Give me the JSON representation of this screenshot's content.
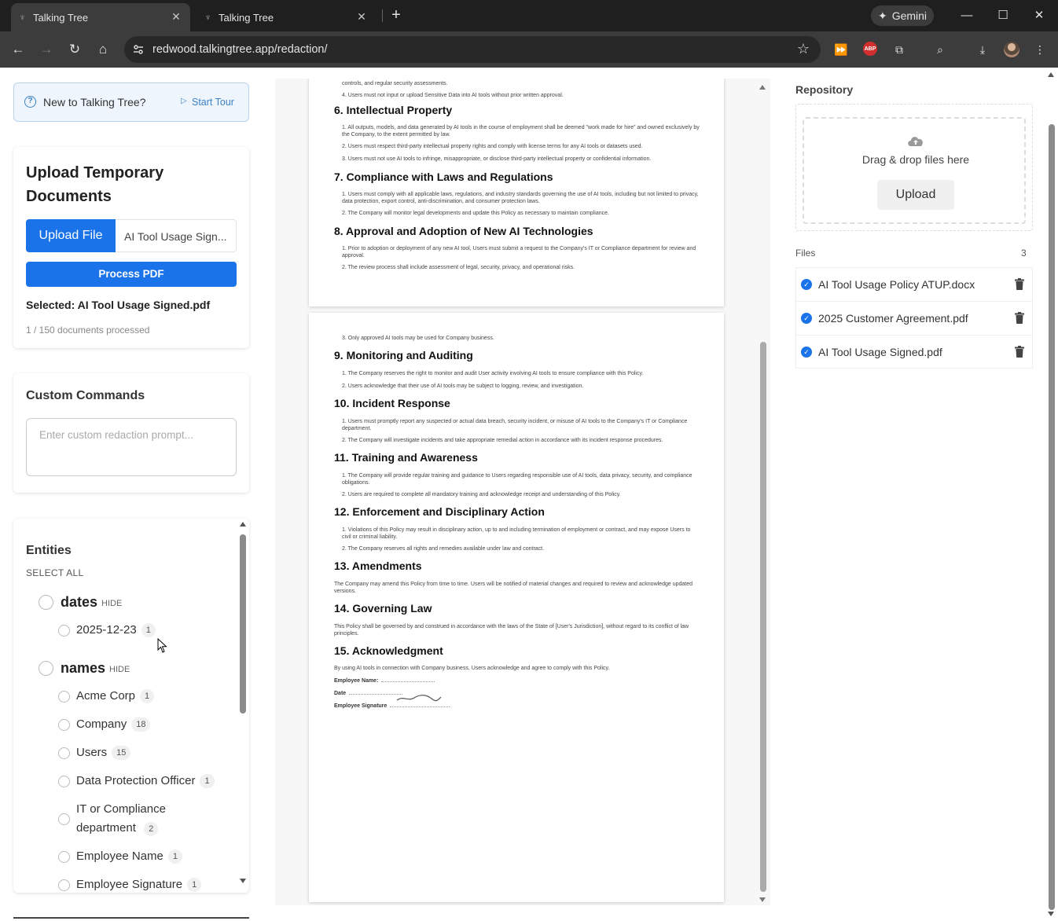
{
  "browser": {
    "tabs": [
      {
        "title": "Talking Tree",
        "active": true
      },
      {
        "title": "Talking Tree",
        "active": false
      }
    ],
    "gemini_label": "Gemini",
    "url": "redwood.talkingtree.app/redaction/",
    "abp_label": "ABP"
  },
  "tour": {
    "title": "New to Talking Tree?",
    "start_label": "Start Tour"
  },
  "upload": {
    "heading": "Upload Temporary Documents",
    "upload_file_label": "Upload File",
    "chosen_file": "AI Tool Usage Sign...",
    "process_label": "Process PDF",
    "selected_text": "Selected: AI Tool Usage Signed.pdf",
    "processed_text": "1 / 150 documents processed"
  },
  "custom_commands": {
    "heading": "Custom Commands",
    "placeholder": "Enter custom redaction prompt..."
  },
  "entities": {
    "heading": "Entities",
    "select_all": "SELECT ALL",
    "hide_label": "HIDE",
    "groups": [
      {
        "name": "dates",
        "items": [
          {
            "label": "2025-12-23",
            "count": "1"
          }
        ]
      },
      {
        "name": "names",
        "items": [
          {
            "label": "Acme Corp",
            "count": "1"
          },
          {
            "label": "Company",
            "count": "18"
          },
          {
            "label": "Users",
            "count": "15"
          },
          {
            "label": "Data Protection Officer",
            "count": "1"
          },
          {
            "label": "IT or Compliance department",
            "count": "2"
          },
          {
            "label": "Employee Name",
            "count": "1"
          },
          {
            "label": "Employee Signature",
            "count": "1"
          }
        ]
      }
    ]
  },
  "document": {
    "page1": {
      "top_fragment": "controls, and regular security assessments.",
      "top_item": "4. Users must not input or upload Sensitive Data into AI tools without prior written approval.",
      "sections": [
        {
          "title": "6. Intellectual Property",
          "items": [
            "1. All outputs, models, and data generated by AI tools in the course of employment shall be deemed \"work made for hire\" and owned exclusively by the Company, to the extent permitted by law.",
            "2. Users must respect third-party intellectual property rights and comply with license terms for any AI tools or datasets used.",
            "3. Users must not use AI tools to infringe, misappropriate, or disclose third-party intellectual property or confidential information."
          ]
        },
        {
          "title": "7. Compliance with Laws and Regulations",
          "items": [
            "1. Users must comply with all applicable laws, regulations, and industry standards governing the use of AI tools, including but not limited to privacy, data protection, export control, anti-discrimination, and consumer protection laws.",
            "2. The Company will monitor legal developments and update this Policy as necessary to maintain compliance."
          ]
        },
        {
          "title": "8. Approval and Adoption of New AI Technologies",
          "items": [
            "1. Prior to adoption or deployment of any new AI tool, Users must submit a request to the Company's IT or Compliance department for review and approval.",
            "2. The review process shall include assessment of legal, security, privacy, and operational risks."
          ]
        }
      ]
    },
    "page2": {
      "top_item": "3. Only approved AI tools may be used for Company business.",
      "sections": [
        {
          "title": "9. Monitoring and Auditing",
          "items": [
            "1. The Company reserves the right to monitor and audit User activity involving AI tools to ensure compliance with this Policy.",
            "2. Users acknowledge that their use of AI tools may be subject to logging, review, and investigation."
          ]
        },
        {
          "title": "10. Incident Response",
          "items": [
            "1. Users must promptly report any suspected or actual data breach, security incident, or misuse of AI tools to the Company's IT or Compliance department.",
            "2. The Company will investigate incidents and take appropriate remedial action in accordance with its incident response procedures."
          ]
        },
        {
          "title": "11. Training and Awareness",
          "items": [
            "1. The Company will provide regular training and guidance to Users regarding responsible use of AI tools, data privacy, security, and compliance obligations.",
            "2. Users are required to complete all mandatory training and acknowledge receipt and understanding of this Policy."
          ]
        },
        {
          "title": "12. Enforcement and Disciplinary Action",
          "items": [
            "1. Violations of this Policy may result in disciplinary action, up to and including termination of employment or contract, and may expose Users to civil or criminal liability.",
            "2. The Company reserves all rights and remedies available under law and contract."
          ]
        },
        {
          "title": "13. Amendments",
          "paragraph": "The Company may amend this Policy from time to time. Users will be notified of material changes and required to review and acknowledge updated versions."
        },
        {
          "title": "14. Governing Law",
          "paragraph": "This Policy shall be governed by and construed in accordance with the laws of the State of [User's Jurisdiction], without regard to its conflict of law principles."
        },
        {
          "title": "15. Acknowledgment",
          "paragraph": "By using AI tools in connection with Company business, Users acknowledge and agree to comply with this Policy."
        }
      ],
      "signature_fields": [
        "Employee Name:",
        "Date",
        "Employee Signature"
      ]
    }
  },
  "repository": {
    "heading": "Repository",
    "drop_text": "Drag & drop files here",
    "upload_label": "Upload",
    "files_label": "Files",
    "files_count": "3",
    "files": [
      "AI Tool Usage Policy ATUP.docx",
      "2025 Customer Agreement.pdf",
      "AI Tool Usage Signed.pdf"
    ]
  },
  "colors": {
    "accent": "#1a73e8",
    "tour_bg": "#eef5fd",
    "chrome_dark": "#1f1f1f"
  }
}
